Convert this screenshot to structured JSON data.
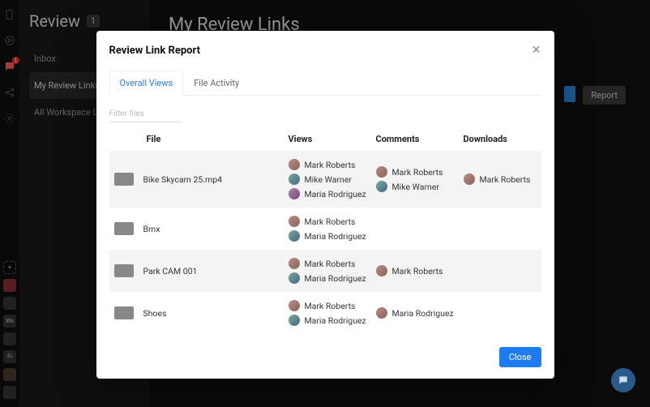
{
  "rail": {
    "notif_badge": "1"
  },
  "section": {
    "title": "Review",
    "count": "1",
    "items": [
      "Inbox",
      "My Review Links",
      "All Workspace Links"
    ],
    "active_index": 1
  },
  "main": {
    "title": "My Review Links",
    "report_btn": "Report"
  },
  "dialog": {
    "title": "Review Link Report",
    "tabs": [
      "Overall Views",
      "File Activity"
    ],
    "active_tab": 0,
    "filter_placeholder": "Filter files",
    "columns": {
      "file": "File",
      "views": "Views",
      "comments": "Comments",
      "downloads": "Downloads"
    },
    "rows": [
      {
        "file": "Bike Skycam 25.mp4",
        "views": [
          "Mark Roberts",
          "Mike Warner",
          "Maria Rodriguez"
        ],
        "comments": [
          "Mark Roberts",
          "Mike Warner"
        ],
        "downloads": [
          "Mark Roberts"
        ]
      },
      {
        "file": "Bmx",
        "views": [
          "Mark Roberts",
          "Maria Rodriguez"
        ],
        "comments": [],
        "downloads": []
      },
      {
        "file": "Park CAM 001",
        "views": [
          "Mark Roberts",
          "Maria Rodriguez"
        ],
        "comments": [
          "Mark Roberts"
        ],
        "downloads": []
      },
      {
        "file": "Shoes",
        "views": [
          "Mark Roberts",
          "Maria Rodriguez"
        ],
        "comments": [
          "Maria Rodriguez"
        ],
        "downloads": []
      }
    ],
    "close_label": "Close"
  },
  "ws_labels": [
    "",
    "",
    "Ws",
    "",
    "Fi",
    "",
    ""
  ]
}
